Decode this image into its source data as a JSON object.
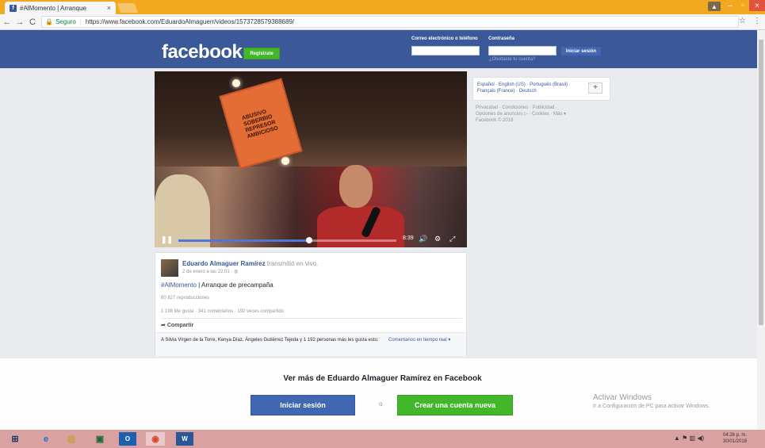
{
  "browser": {
    "tab_title": "#AlMomento | Arranque",
    "tab_close": "×",
    "url_secure": "Seguro",
    "url": "https://www.facebook.com/EduardoAlmaguerr/videos/1573728579388689/",
    "back": "←",
    "forward": "→",
    "reload": "C",
    "star": "☆",
    "menu": "⋮",
    "win_min": "–",
    "win_max": "▫",
    "win_close": "×",
    "win_user": "▲"
  },
  "header": {
    "logo": "facebook",
    "register_label": "Regístrate",
    "email_label": "Correo electrónico o teléfono",
    "password_label": "Contraseña",
    "login_label": "Iniciar sesión",
    "forgot_label": "¿Olvidaste tu cuenta?"
  },
  "video": {
    "sign_lines": [
      "ABUSIVO",
      "SOBERBIO",
      "REPRESOR",
      "AMBICIOSO"
    ],
    "time": "8:39",
    "progress": 0.6
  },
  "languages": {
    "lang1": "Español",
    "lang2": "English (US)",
    "lang3": "Português (Brasil)",
    "lang4": "Français (France)",
    "lang5": "Deutsch",
    "plus": "+",
    "footer_line1": "Privacidad · Condiciones · Publicidad ·",
    "footer_line2": "Opciones de anuncios ▷ · Cookies · Más ▾",
    "footer_line3": "Facebook © 2018"
  },
  "post": {
    "author": "Eduardo Almaguer Ramírez",
    "action": "transmitió en vivo.",
    "date": "2 de enero a las 22:01 · ◍",
    "hashtag": "#AlMomento",
    "text": " | Arranque de precampaña",
    "views": "60 827 reproducciones",
    "stats": "1 198 Me gusta · 341 comentarios · 192 veces compartido",
    "share": "Compartir",
    "likes_text": "A Silvia Virgen de la Torre, Kenya Díaz, Ángeles Gutiérrez Tejeda y 1 192 personas más les gusta esto.",
    "live_comments": "Comentarios en tiempo real ▾"
  },
  "overlay": {
    "title": "Ver más de Eduardo Almaguer Ramírez en Facebook",
    "login": "Iniciar sesión",
    "or": "o",
    "create": "Crear una cuenta nueva"
  },
  "windows": {
    "activate_title": "Activar Windows",
    "activate_sub": "Ir a Configuración de PC para activar Windows.",
    "time": "04:26 p. m.",
    "date": "30/01/2018"
  },
  "colors": {
    "fb_blue": "#3b5998",
    "green": "#42b72a"
  }
}
